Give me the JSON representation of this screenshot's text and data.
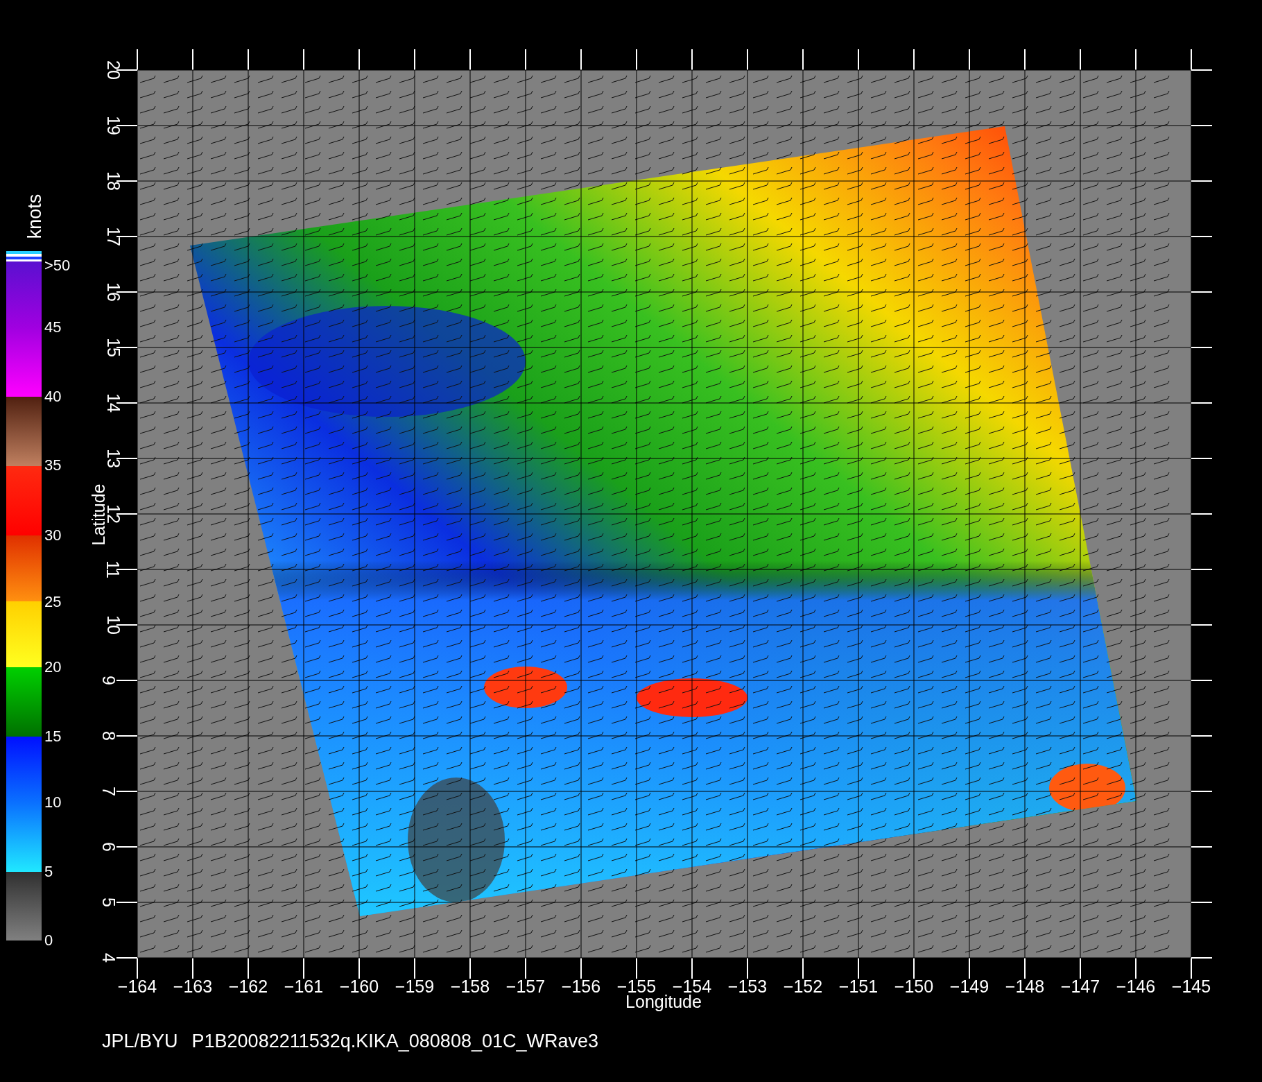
{
  "plot": {
    "x_axis": {
      "label": "Longitude",
      "ticks": [
        "−164",
        "−163",
        "−162",
        "−161",
        "−160",
        "−159",
        "−158",
        "−157",
        "−156",
        "−155",
        "−154",
        "−153",
        "−152",
        "−151",
        "−150",
        "−149",
        "−148",
        "−147",
        "−146",
        "−145"
      ]
    },
    "y_axis": {
      "label": "Latitude",
      "ticks": [
        "20",
        "19",
        "18",
        "17",
        "16",
        "15",
        "14",
        "13",
        "12",
        "11",
        "10",
        "9",
        "8",
        "7",
        "6",
        "5",
        "4"
      ]
    }
  },
  "colorbar": {
    "unit": "knots",
    "labels": [
      ">50",
      "45",
      "40",
      "35",
      "30",
      "25",
      "20",
      "15",
      "10",
      "5",
      "0"
    ]
  },
  "footer": [
    "JPL/BYU",
    "P1B20082211532q.KIKA_080808_01C_WRave3"
  ]
}
